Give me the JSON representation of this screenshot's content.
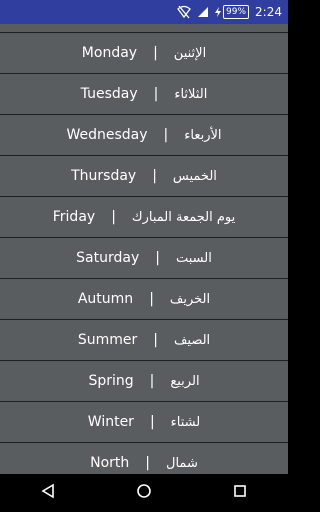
{
  "status_bar": {
    "battery_percent": "99%",
    "time": "2:24",
    "icons": [
      "wifi-off-icon",
      "signal-icon",
      "battery-charging-icon"
    ]
  },
  "list": [
    {
      "english": "Monday",
      "separator": "|",
      "arabic": "الإثنين"
    },
    {
      "english": "Tuesday",
      "separator": "|",
      "arabic": "الثلاثاء"
    },
    {
      "english": "Wednesday",
      "separator": "|",
      "arabic": "الأربعاء"
    },
    {
      "english": "Thursday",
      "separator": "|",
      "arabic": "الخميس"
    },
    {
      "english": "Friday",
      "separator": "|",
      "arabic": "يوم الجمعة المبارك"
    },
    {
      "english": "Saturday",
      "separator": "|",
      "arabic": "السبت"
    },
    {
      "english": "Autumn",
      "separator": "|",
      "arabic": "الخريف"
    },
    {
      "english": "Summer",
      "separator": "|",
      "arabic": "الصيف"
    },
    {
      "english": "Spring",
      "separator": "|",
      "arabic": "الربيع"
    },
    {
      "english": "Winter",
      "separator": "|",
      "arabic": "لشتاء"
    },
    {
      "english": "North",
      "separator": "|",
      "arabic": "شمال"
    }
  ],
  "nav_bar": {
    "icons": [
      "back-icon",
      "home-icon",
      "recents-icon"
    ]
  },
  "colors": {
    "status_bar": "#303F9F",
    "list_background": "#5a5d5f",
    "divider": "#1d1f20",
    "text": "#ffffff"
  }
}
